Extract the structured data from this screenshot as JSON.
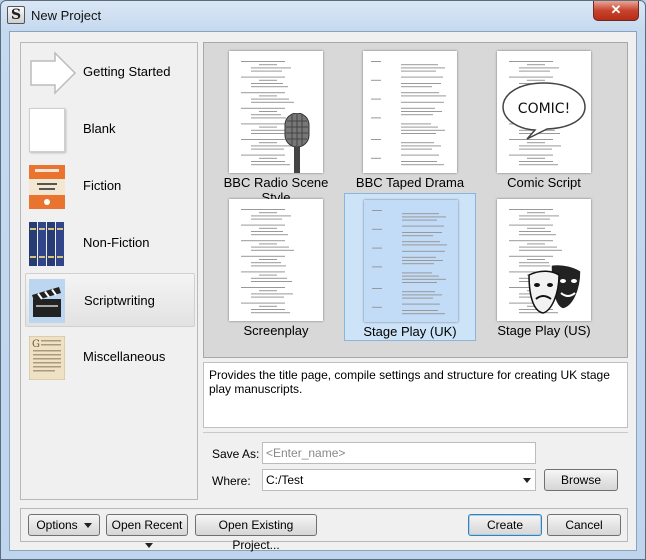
{
  "window": {
    "title": "New Project",
    "close_symbol": "✕"
  },
  "categories": [
    {
      "label": "Getting Started",
      "icon": "arrow-icon"
    },
    {
      "label": "Blank",
      "icon": "blank-page-icon"
    },
    {
      "label": "Fiction",
      "icon": "book-icon"
    },
    {
      "label": "Non-Fiction",
      "icon": "books-icon"
    },
    {
      "label": "Scriptwriting",
      "icon": "clapperboard-icon",
      "selected": true
    },
    {
      "label": "Miscellaneous",
      "icon": "old-page-icon"
    }
  ],
  "templates": [
    {
      "label": "BBC Radio Scene Style",
      "overlay": "microphone-icon"
    },
    {
      "label": "BBC Taped Drama"
    },
    {
      "label": "Comic Script",
      "overlay_text": "COMIC!"
    },
    {
      "label": "Screenplay"
    },
    {
      "label": "Stage Play (UK)",
      "selected": true
    },
    {
      "label": "Stage Play (US)",
      "overlay": "theatre-masks-icon"
    }
  ],
  "description": "Provides the title page, compile settings and structure for creating UK stage play manuscripts.",
  "save_as": {
    "label": "Save As:",
    "placeholder": "<Enter_name>"
  },
  "where": {
    "label": "Where:",
    "value": "C:/Test"
  },
  "buttons": {
    "browse": "Browse",
    "options": "Options",
    "open_recent": "Open Recent",
    "open_existing": "Open Existing Project...",
    "create": "Create",
    "cancel": "Cancel"
  }
}
